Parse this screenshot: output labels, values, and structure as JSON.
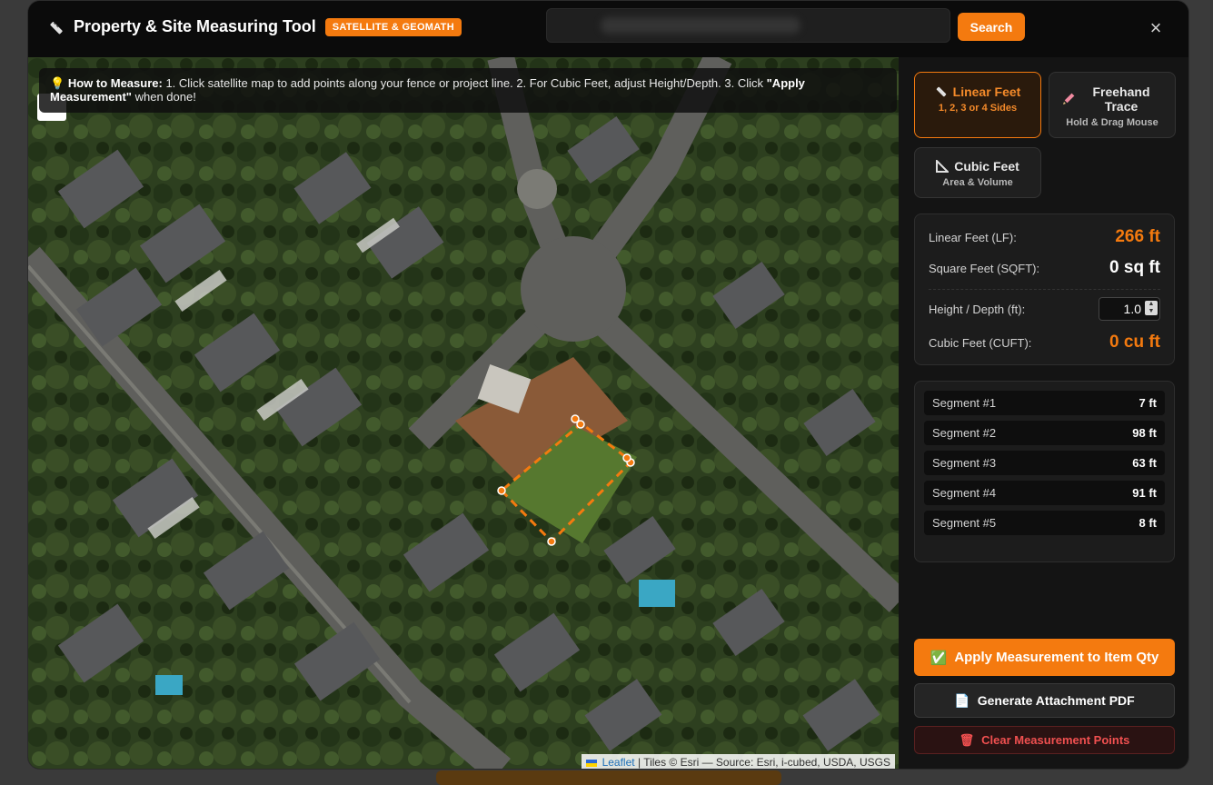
{
  "header": {
    "title": "Property & Site Measuring Tool",
    "badge": "SATELLITE & GEOMATH",
    "search_value": "",
    "search_button": "Search",
    "close_glyph": "×"
  },
  "howto": {
    "lead": "How to Measure:",
    "text": "1. Click satellite map to add points along your fence or project line. 2. For Cubic Feet, adjust Height/Depth. 3. Click",
    "bold": "\"Apply Measurement\"",
    "tail": "when done!"
  },
  "attribution": {
    "leaflet": "Leaflet",
    "tiles": "| Tiles © Esri — Source: Esri, i-cubed, USDA, USGS"
  },
  "modes": [
    {
      "title": "Linear Feet",
      "subtitle": "1, 2, 3 or 4 Sides",
      "icon": "ruler-icon",
      "active": true
    },
    {
      "title": "Freehand Trace",
      "subtitle": "Hold & Drag Mouse",
      "icon": "pencil-icon",
      "active": false
    },
    {
      "title": "Cubic Feet",
      "subtitle": "Area & Volume",
      "icon": "triangle-ruler-icon",
      "active": false
    }
  ],
  "stats": {
    "linear_label": "Linear Feet (LF):",
    "linear_value": "266 ft",
    "square_label": "Square Feet (SQFT):",
    "square_value": "0 sq ft",
    "height_label": "Height / Depth (ft):",
    "height_value": "1.0",
    "cubic_label": "Cubic Feet (CUFT):",
    "cubic_value": "0 cu ft"
  },
  "segments": [
    {
      "label": "Segment #1",
      "value": "7 ft"
    },
    {
      "label": "Segment #2",
      "value": "98 ft"
    },
    {
      "label": "Segment #3",
      "value": "63 ft"
    },
    {
      "label": "Segment #4",
      "value": "91 ft"
    },
    {
      "label": "Segment #5",
      "value": "8 ft"
    }
  ],
  "buttons": {
    "apply": "Apply Measurement to Item Qty",
    "pdf": "Generate Attachment PDF",
    "clear": "Clear Measurement Points"
  },
  "colors": {
    "accent": "#f47a0f",
    "danger": "#f05050",
    "panel": "#1c1c1c"
  }
}
